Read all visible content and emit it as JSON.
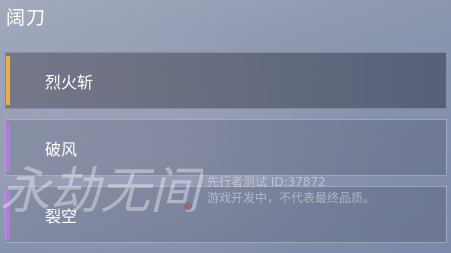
{
  "header": {
    "title": "阔刀"
  },
  "skills": [
    {
      "name": "烈火斩",
      "accent": "#e8b04a",
      "selected": true
    },
    {
      "name": "破风",
      "accent": "#b57ae0",
      "selected": false
    },
    {
      "name": "裂空",
      "accent": "#b57ae0",
      "selected": false
    }
  ],
  "watermark": {
    "logo_text": "永劫无间",
    "line1": "先行者测试   ID:37872",
    "line2": "游戏开发中，不代表最终品质。"
  },
  "colors": {
    "selected_accent": "#e8b04a",
    "default_accent": "#b57ae0"
  }
}
